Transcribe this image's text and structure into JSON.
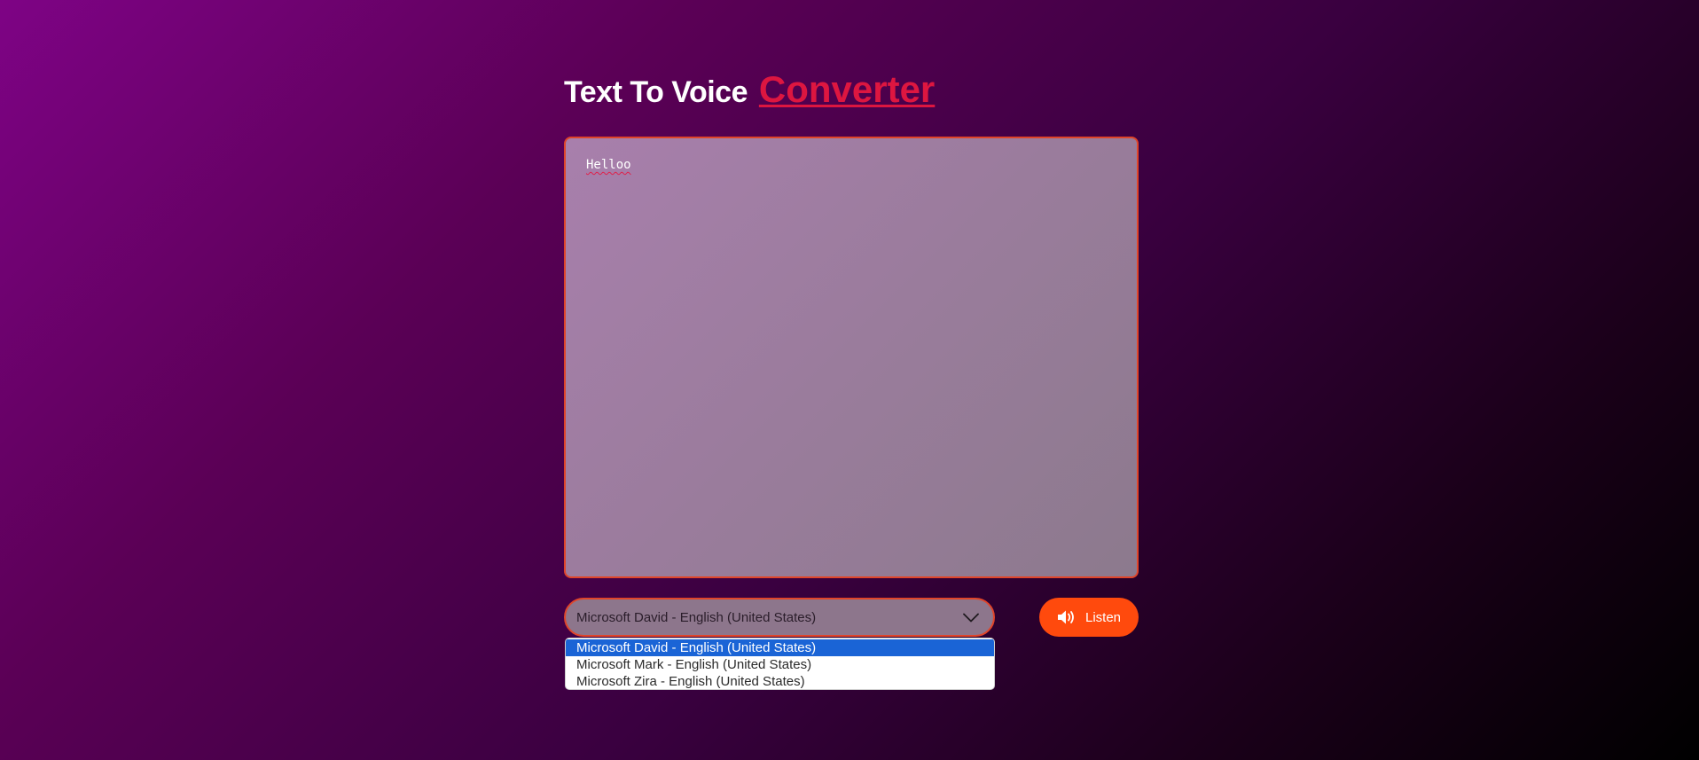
{
  "header": {
    "title_main": "Text To Voice",
    "title_accent": "Converter"
  },
  "editor": {
    "text": "Helloo"
  },
  "voice_select": {
    "selected": "Microsoft David - English (United States)",
    "icon": "chevron-down-icon",
    "options": [
      "Microsoft David - English (United States)",
      "Microsoft Mark - English (United States)",
      "Microsoft Zira - English (United States)"
    ]
  },
  "listen_button": {
    "label": "Listen",
    "icon": "volume-icon"
  },
  "colors": {
    "accent": "#dd1640",
    "button": "#ff4a0d",
    "border": "#e0452a",
    "option_highlight": "#1a64d6"
  }
}
